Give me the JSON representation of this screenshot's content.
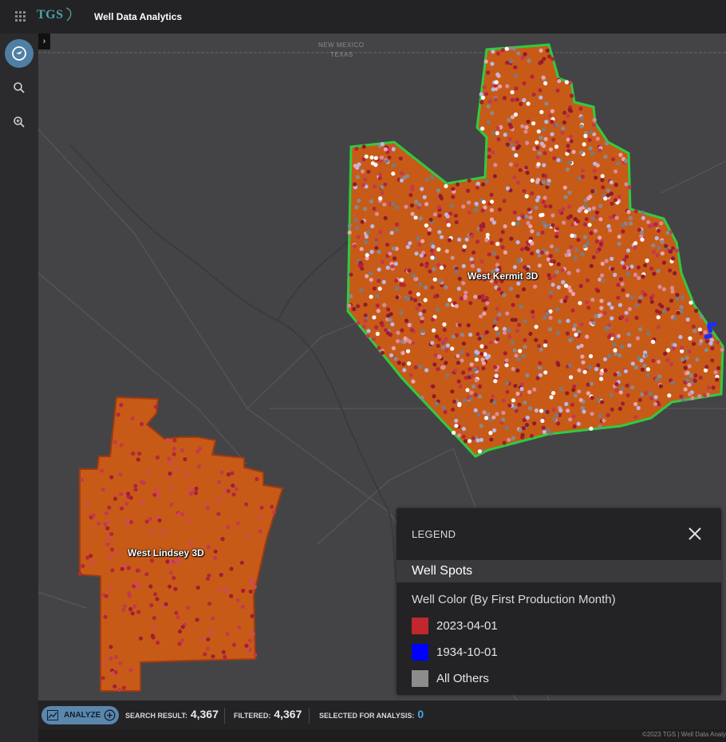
{
  "topbar": {
    "logo": "TGS",
    "title": "Well Data Analytics"
  },
  "map": {
    "state_labels": [
      "NEW MEXICO",
      "TEXAS"
    ],
    "surveys": [
      {
        "name": "West Kermit 3D"
      },
      {
        "name": "West Lindsey 3D"
      }
    ]
  },
  "legend": {
    "title": "LEGEND",
    "section": "Well Spots",
    "subtitle": "Well Color (By First Production Month)",
    "items": [
      {
        "label": "2023-04-01",
        "color": "#c1272d"
      },
      {
        "label": "1934-10-01",
        "color": "#0000ff"
      },
      {
        "label": "All Others",
        "color": "#8c8c8c"
      }
    ]
  },
  "bottom": {
    "analyze_label": "ANALYZE",
    "search_result_label": "SEARCH RESULT:",
    "search_result_value": "4,367",
    "filtered_label": "FILTERED:",
    "filtered_value": "4,367",
    "selected_label": "SELECTED FOR ANALYSIS:",
    "selected_value": "0"
  },
  "footer": {
    "copyright": "©2023 TGS | Well Data Analy"
  },
  "colors": {
    "survey_fill": "#c85a18",
    "kermit_outline": "#2ecc40",
    "lindsey_outline": "#a33a10",
    "accent": "#4f7fa4",
    "selected_value": "#4aa3df"
  }
}
